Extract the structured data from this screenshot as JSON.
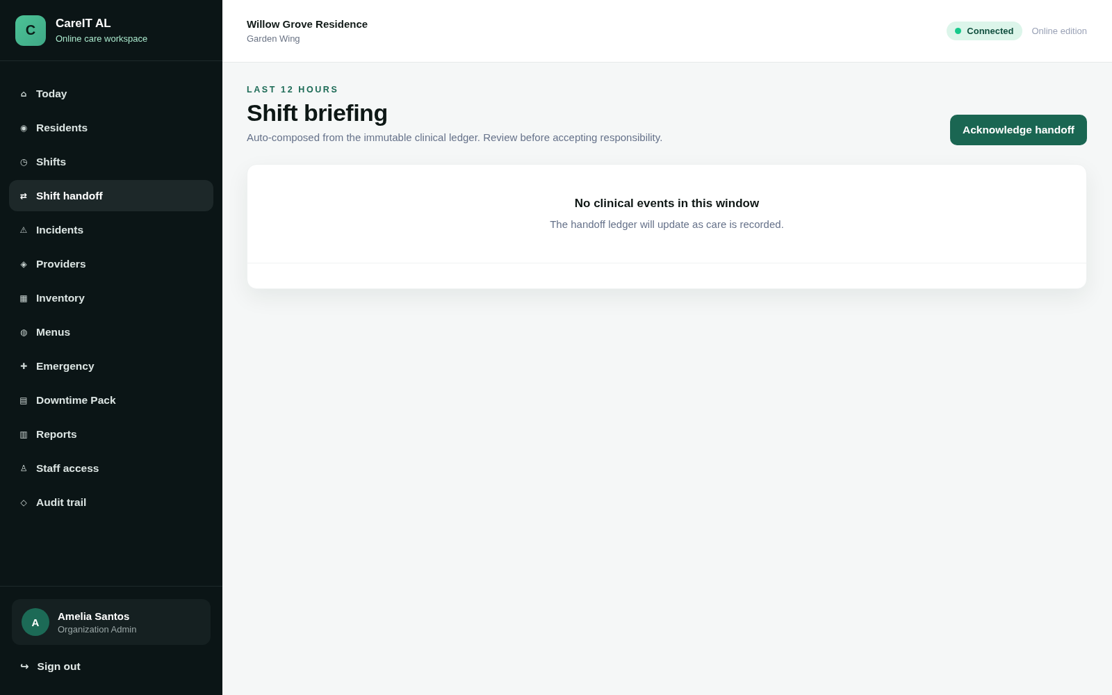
{
  "brand": {
    "logo_letter": "C",
    "name": "CareIT AL",
    "tagline": "Online care workspace"
  },
  "sidebar": {
    "items": [
      {
        "icon": "⌂",
        "label": "Today",
        "selected": false
      },
      {
        "icon": "◉",
        "label": "Residents",
        "selected": false
      },
      {
        "icon": "◷",
        "label": "Shifts",
        "selected": false
      },
      {
        "icon": "⇄",
        "label": "Shift handoff",
        "selected": true
      },
      {
        "icon": "⚠",
        "label": "Incidents",
        "selected": false
      },
      {
        "icon": "◈",
        "label": "Providers",
        "selected": false
      },
      {
        "icon": "▦",
        "label": "Inventory",
        "selected": false
      },
      {
        "icon": "◍",
        "label": "Menus",
        "selected": false
      },
      {
        "icon": "✚",
        "label": "Emergency",
        "selected": false
      },
      {
        "icon": "▤",
        "label": "Downtime Pack",
        "selected": false
      },
      {
        "icon": "▥",
        "label": "Reports",
        "selected": false
      },
      {
        "icon": "♙",
        "label": "Staff access",
        "selected": false
      },
      {
        "icon": "◇",
        "label": "Audit trail",
        "selected": false
      }
    ],
    "user": {
      "avatar_letter": "A",
      "name": "Amelia Santos",
      "role": "Organization Admin"
    },
    "sign_out": {
      "icon": "↪",
      "label": "Sign out"
    }
  },
  "header": {
    "facility": "Willow Grove Residence",
    "unit": "Garden Wing",
    "status": {
      "label": "Connected",
      "connected": true
    },
    "edition": "Online edition"
  },
  "page": {
    "eyebrow": "LAST 12 HOURS",
    "title": "Shift briefing",
    "description": "Auto-composed from the immutable clinical ledger. Review before accepting responsibility.",
    "action": "Acknowledge handoff"
  },
  "card": {
    "empty_title": "No clinical events in this window",
    "empty_text": "The handoff ledger will update as care is recorded."
  }
}
